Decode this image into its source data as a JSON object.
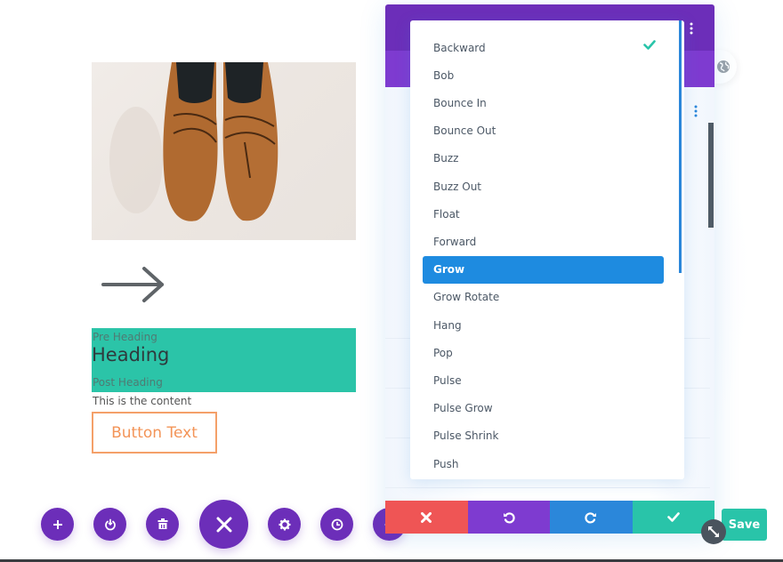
{
  "page": {
    "product_image_alt": "brown leather shoes",
    "pre_heading": "Pre Heading",
    "heading": "Heading",
    "post_heading": "Post Heading",
    "content": "This is the content",
    "button_text": "Button Text"
  },
  "toolbar": {
    "items": [
      {
        "icon": "plus-icon",
        "label": "Add"
      },
      {
        "icon": "power-icon",
        "label": "Disable"
      },
      {
        "icon": "trash-icon",
        "label": "Delete"
      },
      {
        "icon": "close-icon",
        "label": "Close"
      },
      {
        "icon": "gear-icon",
        "label": "Settings"
      },
      {
        "icon": "history-icon",
        "label": "History"
      },
      {
        "icon": "more-icon",
        "label": "More"
      }
    ]
  },
  "modal": {
    "title": "",
    "tab": "",
    "footer": {
      "discard": "discard",
      "undo": "undo",
      "redo": "redo",
      "confirm": "confirm"
    }
  },
  "dropdown": {
    "checked_value": "Backward",
    "selected_value": "Grow",
    "options": [
      "Backward",
      "Bob",
      "Bounce In",
      "Bounce Out",
      "Buzz",
      "Buzz Out",
      "Float",
      "Forward",
      "Grow",
      "Grow Rotate",
      "Hang",
      "Pop",
      "Pulse",
      "Pulse Grow",
      "Pulse Shrink",
      "Push"
    ]
  },
  "save": {
    "label": "Save"
  },
  "colors": {
    "purple": "#6c2eb9",
    "purple_light": "#7e3bd0",
    "blue": "#2b87da",
    "selected_blue": "#1e8be0",
    "teal": "#29c4a9",
    "red": "#ef5555",
    "orange": "#f39458"
  }
}
